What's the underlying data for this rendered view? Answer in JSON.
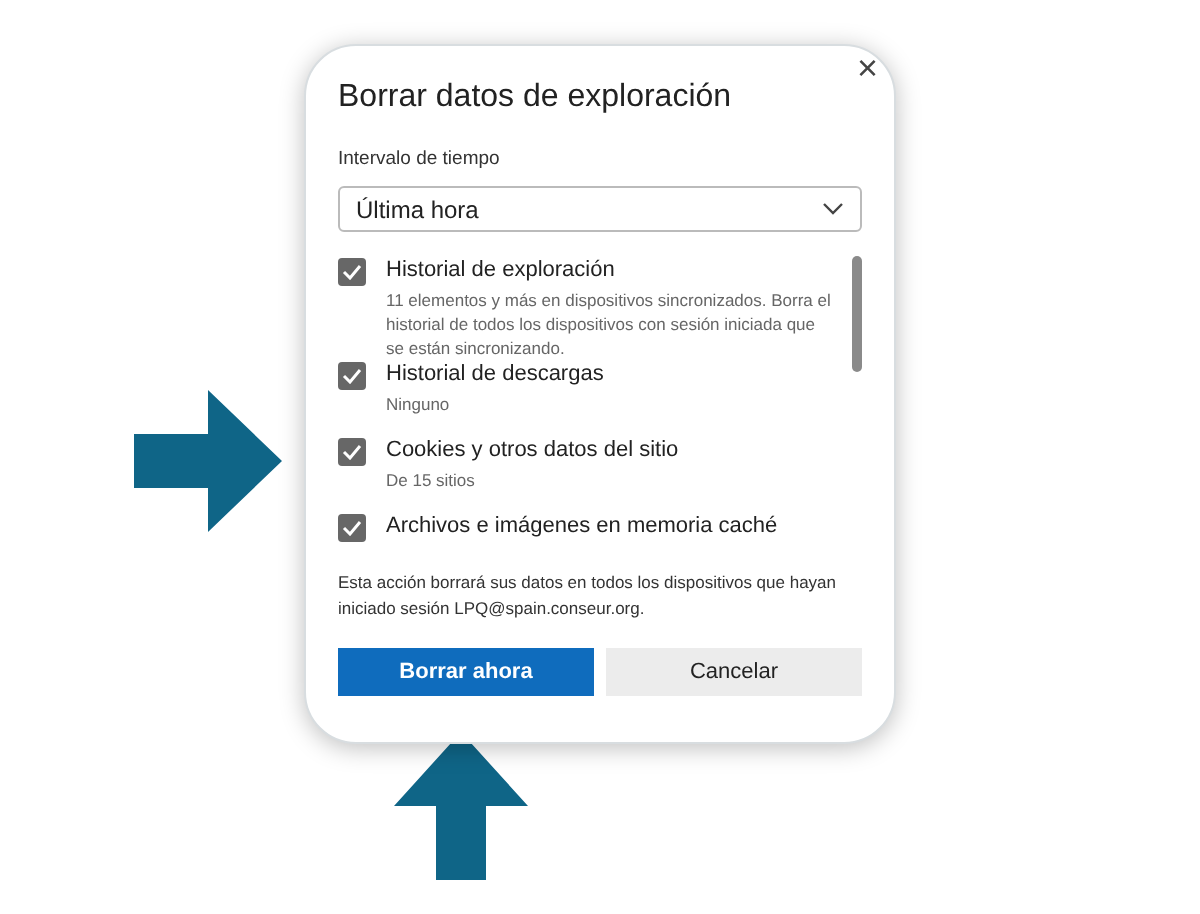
{
  "dialog": {
    "title": "Borrar datos de exploración",
    "close": "×",
    "time_range": {
      "label": "Intervalo de tiempo",
      "value": "Última hora"
    },
    "items": [
      {
        "title": "Historial de exploración",
        "description": "11 elementos y más en dispositivos sincronizados. Borra el historial de todos los dispositivos con sesión iniciada que se están sincronizando.",
        "checked": true
      },
      {
        "title": "Historial de descargas",
        "description": "Ninguno",
        "checked": true
      },
      {
        "title": "Cookies y otros datos del sitio",
        "description": "De 15 sitios",
        "checked": true
      },
      {
        "title": "Archivos e imágenes en memoria caché",
        "checked": true
      }
    ],
    "note": "Esta acción borrará sus datos en todos los dispositivos que hayan iniciado sesión LPQ@spain.conseur.org.",
    "buttons": [
      {
        "label": "Borrar ahora",
        "kind": "primary"
      },
      {
        "label": "Cancelar",
        "kind": "secondary"
      }
    ]
  }
}
